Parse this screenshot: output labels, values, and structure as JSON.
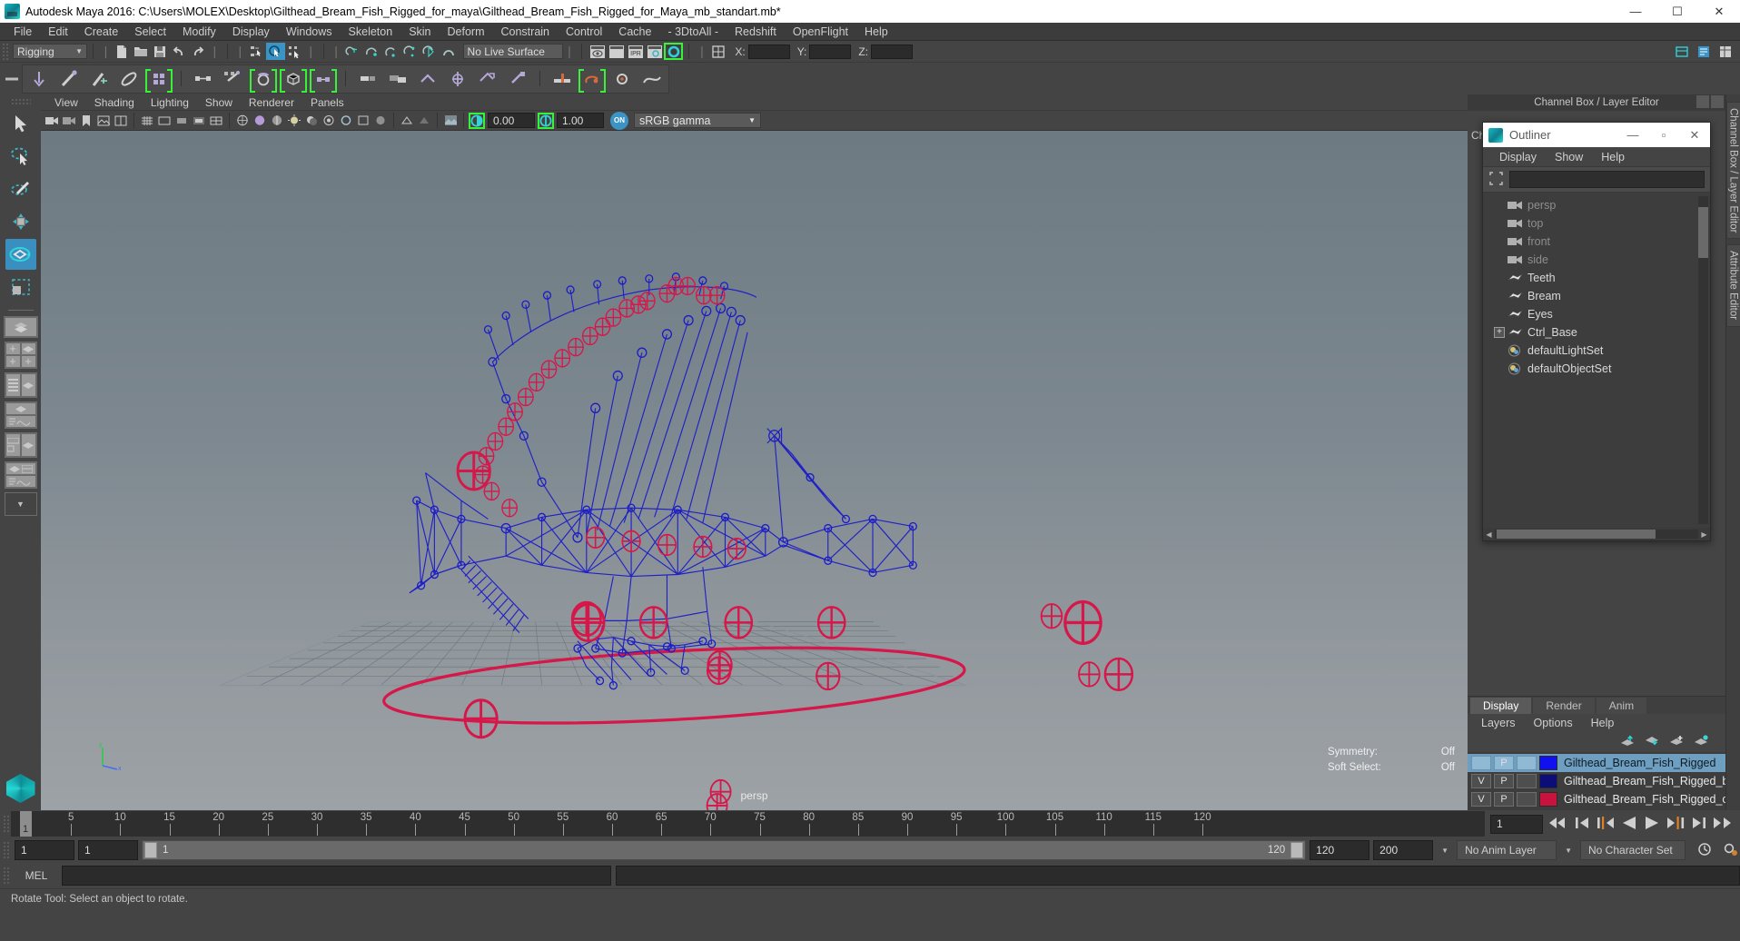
{
  "window": {
    "title": "Autodesk Maya 2016: C:\\Users\\MOLEX\\Desktop\\Gilthead_Bream_Fish_Rigged_for_maya\\Gilthead_Bream_Fish_Rigged_for_Maya_mb_standart.mb*",
    "minimize": "—",
    "maximize": "☐",
    "close": "✕"
  },
  "menubar": [
    "File",
    "Edit",
    "Create",
    "Select",
    "Modify",
    "Display",
    "Windows",
    "Skeleton",
    "Skin",
    "Deform",
    "Constrain",
    "Control",
    "Cache",
    "- 3DtoAll -",
    "Redshift",
    "OpenFlight",
    "Help"
  ],
  "statusline": {
    "menuset": "Rigging",
    "live_surface": "No Live Surface",
    "x_label": "X:",
    "y_label": "Y:",
    "z_label": "Z:",
    "x_value": "",
    "y_value": "",
    "z_value": "",
    "ipr_label": "IPR"
  },
  "viewport_menu": [
    "View",
    "Shading",
    "Lighting",
    "Show",
    "Renderer",
    "Panels"
  ],
  "viewport_toolbar": {
    "exposure": "0.00",
    "gamma": "1.00",
    "color_management": "sRGB gamma",
    "on_badge": "ON"
  },
  "viewport": {
    "camera_label": "persp",
    "hud": [
      {
        "label": "Symmetry:",
        "value": "Off"
      },
      {
        "label": "Soft Select:",
        "value": "Off"
      }
    ],
    "axis_y": "y",
    "axis_x": "x"
  },
  "channelbox": {
    "title": "Channel Box / Layer Editor",
    "side_label_cha": "Cha",
    "vertical_tabs": [
      "Channel Box / Layer Editor",
      "Attribute Editor"
    ]
  },
  "outliner": {
    "title": "Outliner",
    "minimize": "—",
    "maximize": "▫",
    "close": "✕",
    "menus": [
      "Display",
      "Show",
      "Help"
    ],
    "search_value": "",
    "items": [
      {
        "label": "persp",
        "icon": "camera-icon",
        "type": "camera",
        "expandable": false
      },
      {
        "label": "top",
        "icon": "camera-icon",
        "type": "camera",
        "expandable": false
      },
      {
        "label": "front",
        "icon": "camera-icon",
        "type": "camera",
        "expandable": false
      },
      {
        "label": "side",
        "icon": "camera-icon",
        "type": "camera",
        "expandable": false
      },
      {
        "label": "Teeth",
        "icon": "mesh-icon",
        "type": "mesh",
        "expandable": false
      },
      {
        "label": "Bream",
        "icon": "mesh-icon",
        "type": "mesh",
        "expandable": false
      },
      {
        "label": "Eyes",
        "icon": "mesh-icon",
        "type": "mesh",
        "expandable": false
      },
      {
        "label": "Ctrl_Base",
        "icon": "mesh-icon",
        "type": "mesh",
        "expandable": true,
        "expand_glyph": "+"
      },
      {
        "label": "defaultLightSet",
        "icon": "set-icon",
        "type": "set",
        "expandable": false
      },
      {
        "label": "defaultObjectSet",
        "icon": "set-icon",
        "type": "set",
        "expandable": false
      }
    ]
  },
  "layer_editor": {
    "tabs": [
      "Display",
      "Render",
      "Anim"
    ],
    "active_tab": "Display",
    "menus": [
      "Layers",
      "Options",
      "Help"
    ],
    "layers": [
      {
        "v": "",
        "p": "P",
        "third": "",
        "color": "#1010f0",
        "name": "Gilthead_Bream_Fish_Rigged",
        "selected": true
      },
      {
        "v": "V",
        "p": "P",
        "third": "",
        "color": "#0d0d7a",
        "name": "Gilthead_Bream_Fish_Rigged_bone",
        "selected": false
      },
      {
        "v": "V",
        "p": "P",
        "third": "",
        "color": "#c8133f",
        "name": "Gilthead_Bream_Fish_Rigged_contr",
        "selected": false
      }
    ]
  },
  "timeline": {
    "ticks": [
      5,
      10,
      15,
      20,
      25,
      30,
      35,
      40,
      45,
      50,
      55,
      60,
      65,
      70,
      75,
      80,
      85,
      90,
      95,
      100,
      105,
      110,
      115,
      120
    ],
    "current_frame_marker": "1",
    "current_frame_field": "1",
    "range_start": "1",
    "range_end": "1",
    "slider_left_value": "1",
    "slider_right_value": "120",
    "playback_end": "120",
    "anim_end": "200",
    "anim_layer": "No Anim Layer",
    "character_set": "No Character Set"
  },
  "command_line": {
    "language": "MEL",
    "input_value": "",
    "output_value": ""
  },
  "status": {
    "message": "Rotate Tool: Select an object to rotate."
  },
  "colors": {
    "accent_blue": "#3b93c6",
    "highlight_green": "#3bf03b",
    "control_red": "#d6174a",
    "joint_blue": "#1b1bc8",
    "selected_row": "#6f9fc0"
  }
}
